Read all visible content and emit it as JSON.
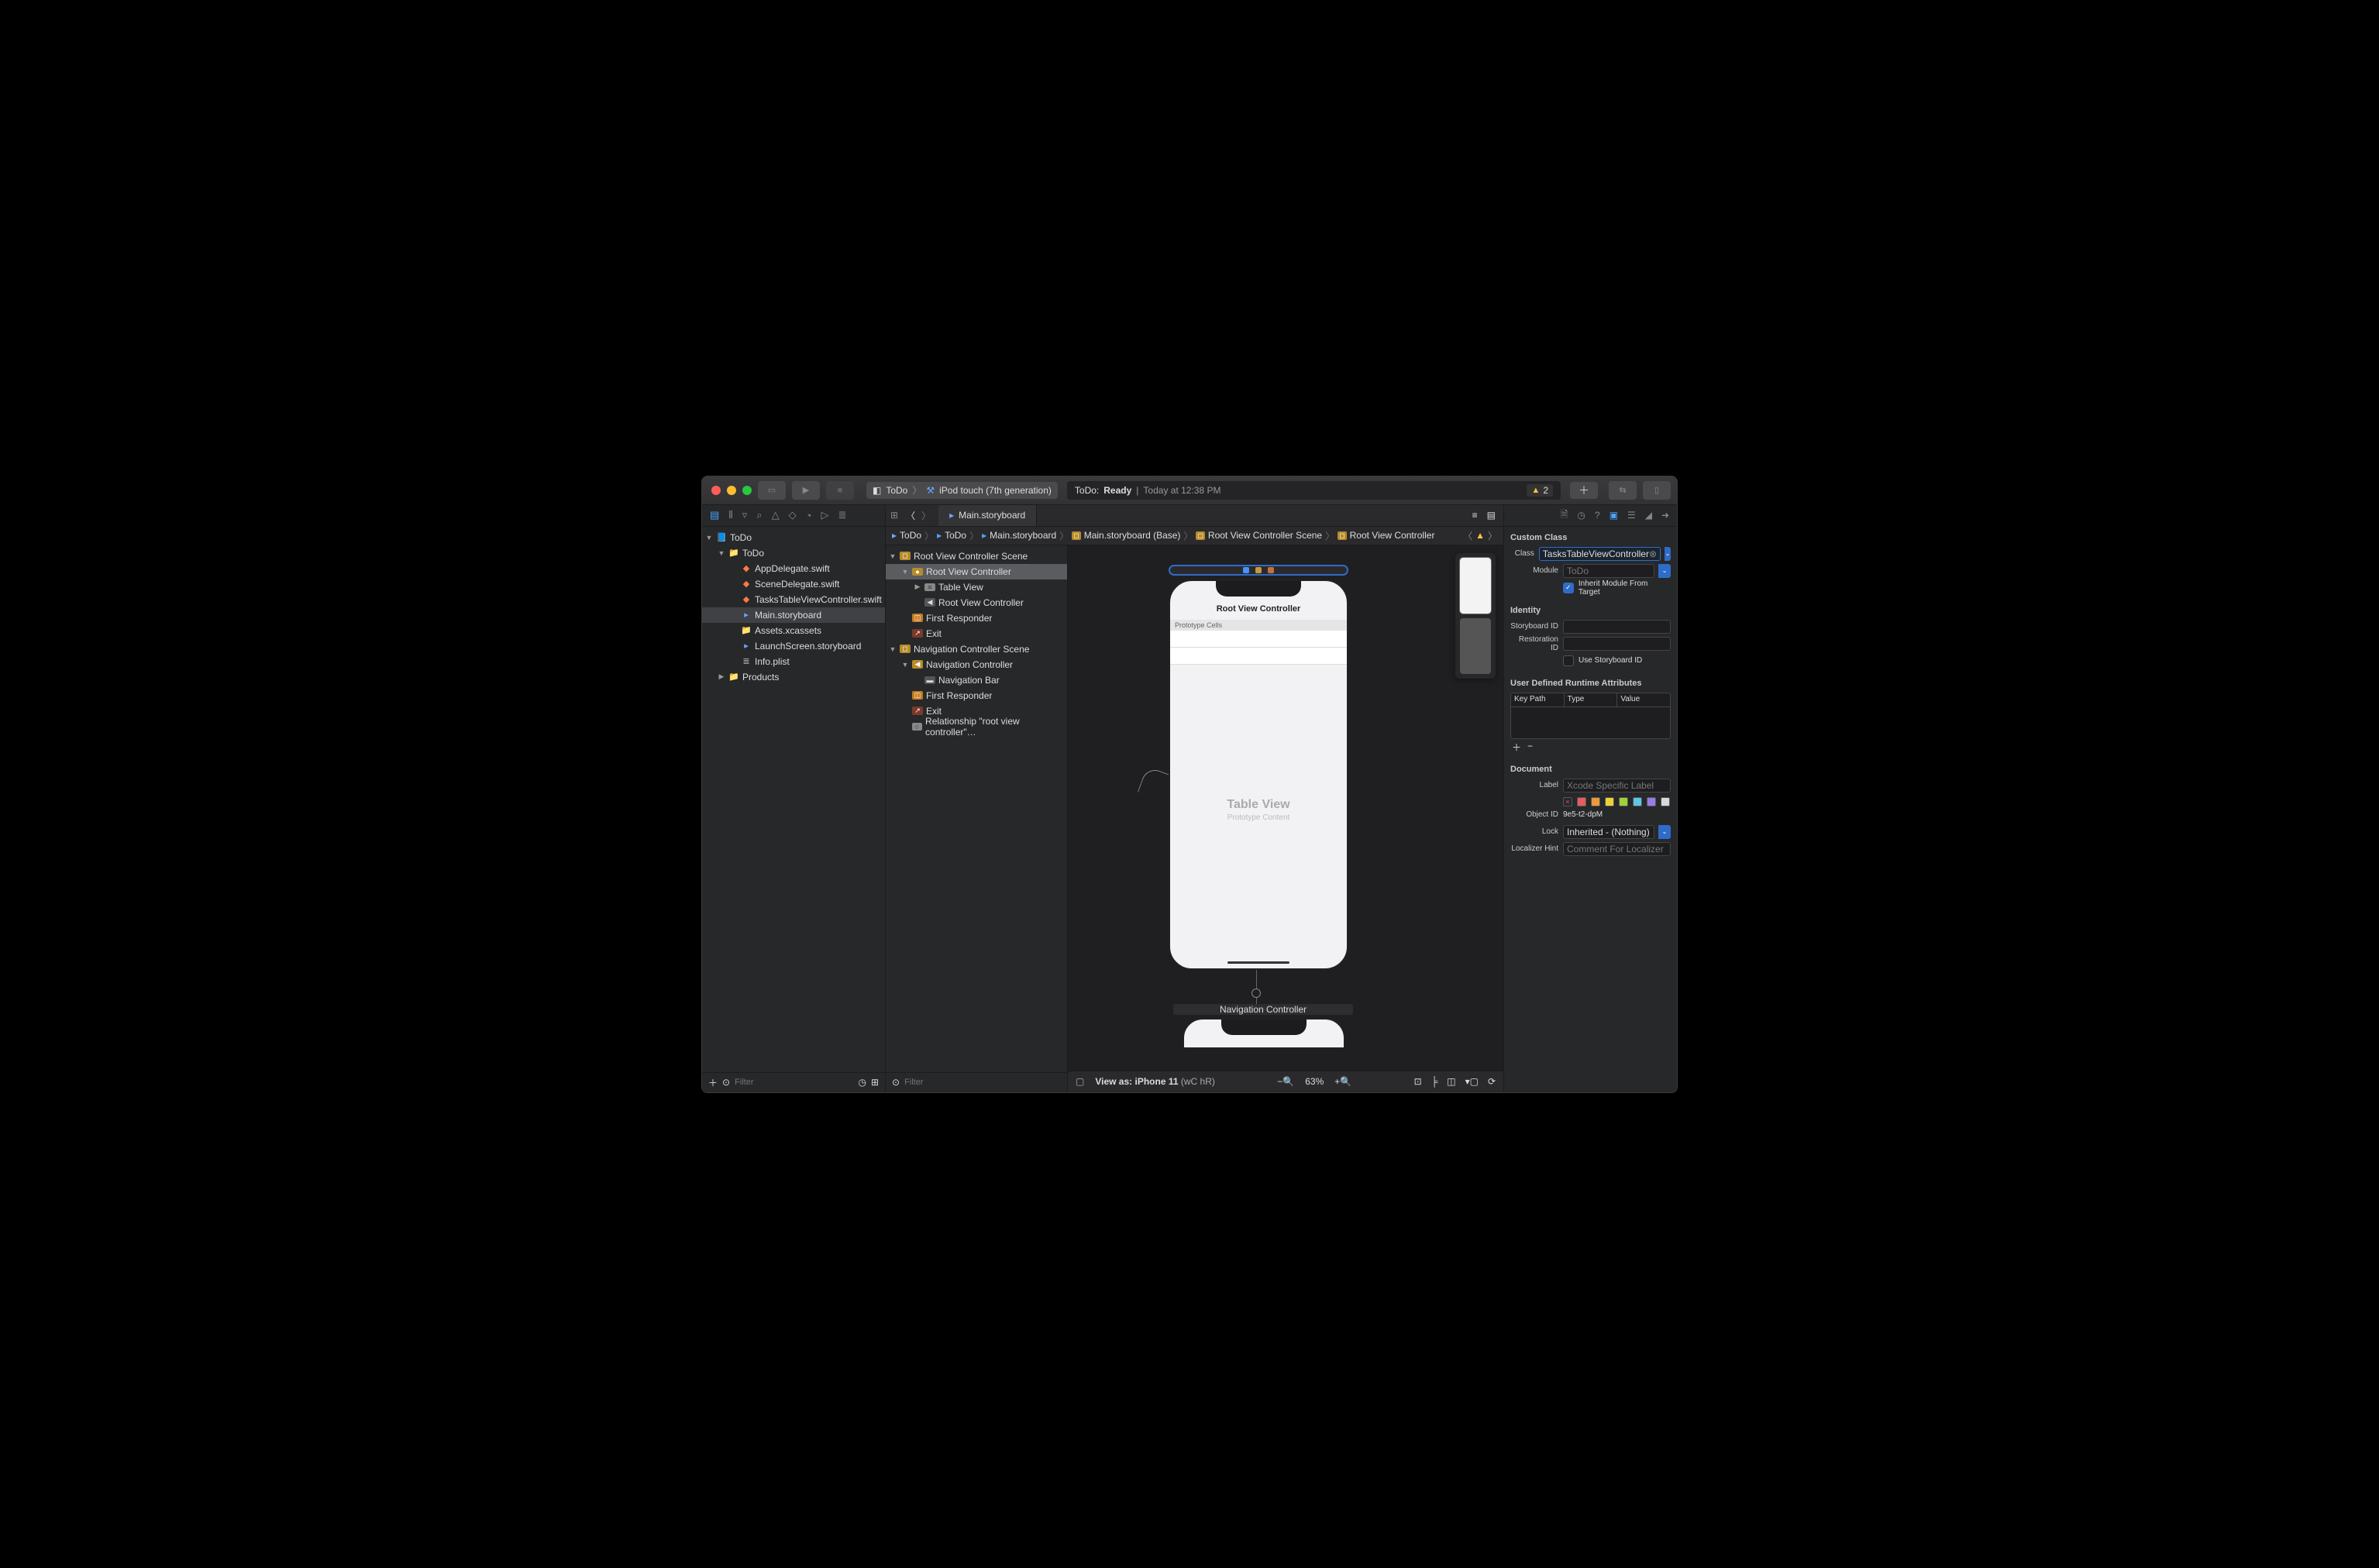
{
  "toolbar": {
    "scheme_target": "ToDo",
    "scheme_device": "iPod touch (7th generation)",
    "activity_project": "ToDo:",
    "activity_status": "Ready",
    "activity_sep": "|",
    "activity_time": "Today at 12:38 PM",
    "warning_count": "2"
  },
  "navigator": {
    "filter_placeholder": "Filter",
    "tree": [
      {
        "indent": 0,
        "disc": "▼",
        "icon": "📘",
        "cls": "sb-blue",
        "label": "ToDo"
      },
      {
        "indent": 1,
        "disc": "▼",
        "icon": "📁",
        "cls": "folder-blue",
        "label": "ToDo"
      },
      {
        "indent": 2,
        "disc": "",
        "icon": "◆",
        "cls": "swift-orange",
        "label": "AppDelegate.swift"
      },
      {
        "indent": 2,
        "disc": "",
        "icon": "◆",
        "cls": "swift-orange",
        "label": "SceneDelegate.swift"
      },
      {
        "indent": 2,
        "disc": "",
        "icon": "◆",
        "cls": "swift-orange",
        "label": "TasksTableViewController.swift"
      },
      {
        "indent": 2,
        "disc": "",
        "icon": "▸",
        "cls": "sb-blue",
        "label": "Main.storyboard",
        "selected": true
      },
      {
        "indent": 2,
        "disc": "",
        "icon": "📁",
        "cls": "assets-teal",
        "label": "Assets.xcassets"
      },
      {
        "indent": 2,
        "disc": "",
        "icon": "▸",
        "cls": "sb-blue",
        "label": "LaunchScreen.storyboard"
      },
      {
        "indent": 2,
        "disc": "",
        "icon": "≣",
        "cls": "plist-grey",
        "label": "Info.plist"
      },
      {
        "indent": 1,
        "disc": "▶",
        "icon": "📁",
        "cls": "folder-blue",
        "label": "Products"
      }
    ]
  },
  "tab": {
    "label": "Main.storyboard"
  },
  "jumpbar": {
    "crumbs": [
      "ToDo",
      "ToDo",
      "Main.storyboard",
      "Main.storyboard (Base)",
      "Root View Controller Scene",
      "Root View Controller"
    ]
  },
  "outline": {
    "filter_placeholder": "Filter",
    "rows": [
      {
        "indent": 0,
        "disc": "▼",
        "icon": "◻",
        "cls": "scene-y",
        "label": "Root View Controller Scene"
      },
      {
        "indent": 1,
        "disc": "▼",
        "icon": "●",
        "cls": "vc-y",
        "label": "Root View Controller",
        "selected": true
      },
      {
        "indent": 2,
        "disc": "▶",
        "icon": "≡",
        "cls": "tv-grey",
        "label": "Table View"
      },
      {
        "indent": 2,
        "disc": "",
        "icon": "◀",
        "cls": "navbar-ic",
        "label": "Root View Controller"
      },
      {
        "indent": 1,
        "disc": "",
        "icon": "◫",
        "cls": "fr-or",
        "label": "First Responder"
      },
      {
        "indent": 1,
        "disc": "",
        "icon": "↗",
        "cls": "exit-red",
        "label": "Exit"
      },
      {
        "indent": 0,
        "disc": "▼",
        "icon": "◻",
        "cls": "scene-y",
        "label": "Navigation Controller Scene"
      },
      {
        "indent": 1,
        "disc": "▼",
        "icon": "◀",
        "cls": "vc-y",
        "label": "Navigation Controller"
      },
      {
        "indent": 2,
        "disc": "",
        "icon": "▬",
        "cls": "navbar-ic",
        "label": "Navigation Bar"
      },
      {
        "indent": 1,
        "disc": "",
        "icon": "◫",
        "cls": "fr-or",
        "label": "First Responder"
      },
      {
        "indent": 1,
        "disc": "",
        "icon": "↗",
        "cls": "exit-red",
        "label": "Exit"
      },
      {
        "indent": 1,
        "disc": "",
        "icon": "○",
        "cls": "rel-grey",
        "label": "Relationship \"root view controller\"…"
      }
    ]
  },
  "canvas": {
    "nav_title": "Root View Controller",
    "proto_cells": "Prototype Cells",
    "tv_label": "Table View",
    "tv_sub": "Prototype Content",
    "navctrl_label": "Navigation Controller",
    "view_as_label": "View as:",
    "view_as_device": "iPhone 11",
    "view_as_traits": "(wC hR)",
    "zoom": "63%"
  },
  "inspector": {
    "sections": {
      "custom_class": "Custom Class",
      "identity": "Identity",
      "runtime": "User Defined Runtime Attributes",
      "document": "Document"
    },
    "class_label": "Class",
    "class_value": "TasksTableViewController",
    "module_label": "Module",
    "module_placeholder": "ToDo",
    "inherit_label": "Inherit Module From Target",
    "storyboard_id_label": "Storyboard ID",
    "restoration_id_label": "Restoration ID",
    "use_storyboard_label": "Use Storyboard ID",
    "runtime_cols": {
      "key": "Key Path",
      "type": "Type",
      "value": "Value"
    },
    "doc_label_label": "Label",
    "doc_label_placeholder": "Xcode Specific Label",
    "object_id_label": "Object ID",
    "object_id_value": "9e5-t2-dpM",
    "lock_label": "Lock",
    "lock_value": "Inherited - (Nothing)",
    "localizer_label": "Localizer Hint",
    "localizer_placeholder": "Comment For Localizer",
    "colors": [
      "#3a3a3c",
      "#e55d5d",
      "#ec9a3a",
      "#ecd23a",
      "#9cd23a",
      "#5dc7e5",
      "#9a7be5",
      "#d9d9d9"
    ]
  }
}
